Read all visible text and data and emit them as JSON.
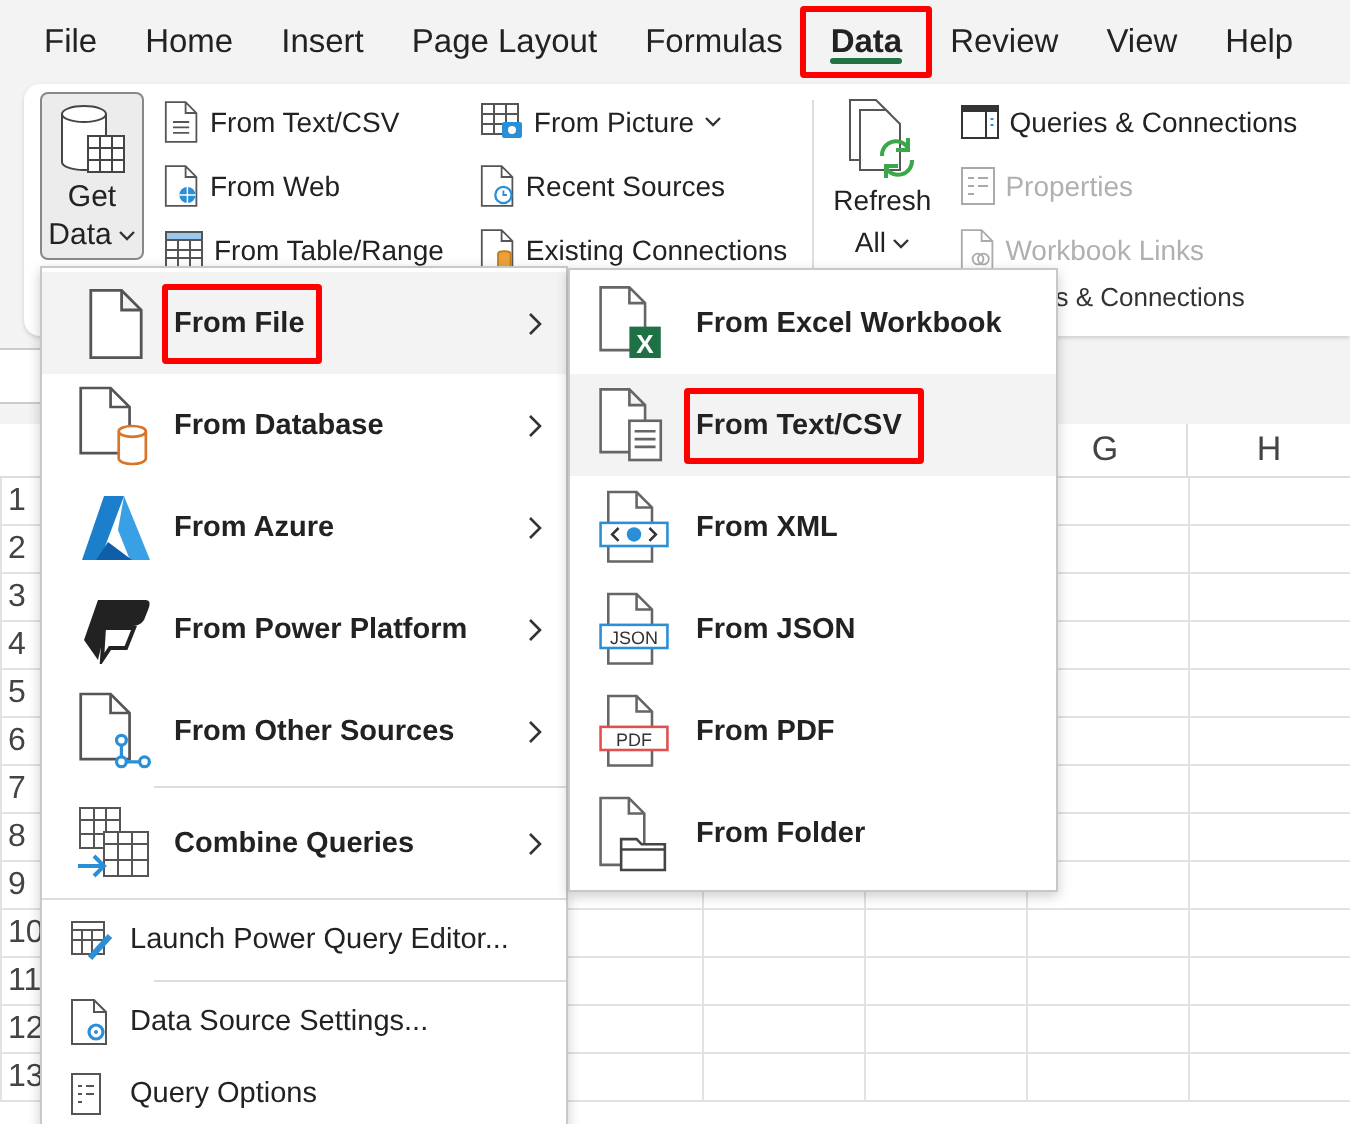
{
  "tabs": [
    {
      "label": "File",
      "selected": false,
      "annotated": false
    },
    {
      "label": "Home",
      "selected": false,
      "annotated": false
    },
    {
      "label": "Insert",
      "selected": false,
      "annotated": false
    },
    {
      "label": "Page Layout",
      "selected": false,
      "annotated": false
    },
    {
      "label": "Formulas",
      "selected": false,
      "annotated": false
    },
    {
      "label": "Data",
      "selected": true,
      "annotated": true
    },
    {
      "label": "Review",
      "selected": false,
      "annotated": false
    },
    {
      "label": "View",
      "selected": false,
      "annotated": false
    },
    {
      "label": "Help",
      "selected": false,
      "annotated": false
    }
  ],
  "ribbon": {
    "get_data": {
      "lines": [
        "Get",
        "Data"
      ],
      "pressed": true
    },
    "import_columns": [
      [
        {
          "label": "From Text/CSV",
          "dropdown": false
        },
        {
          "label": "From Web",
          "dropdown": false
        },
        {
          "label": "From Table/Range",
          "dropdown": false
        }
      ],
      [
        {
          "label": "From Picture",
          "dropdown": true
        },
        {
          "label": "Recent Sources",
          "dropdown": false
        },
        {
          "label": "Existing Connections",
          "dropdown": false
        }
      ]
    ],
    "refresh": {
      "lines": [
        "Refresh",
        "All"
      ]
    },
    "queries": [
      {
        "label": "Queries & Connections",
        "disabled": false
      },
      {
        "label": "Properties",
        "disabled": true
      },
      {
        "label": "Workbook Links",
        "disabled": true
      }
    ],
    "group_label": "s & Connections"
  },
  "grid": {
    "column_headers": [
      "G",
      "H"
    ],
    "row_headers": [
      "1",
      "2",
      "3",
      "4",
      "5",
      "6",
      "7",
      "8",
      "9",
      "10",
      "11",
      "12",
      "13"
    ]
  },
  "menu": {
    "sections": [
      [
        {
          "kind": "source",
          "label": "From File",
          "submenu": true,
          "selected": true,
          "annotated": true
        },
        {
          "kind": "source",
          "label": "From Database",
          "submenu": true,
          "selected": false,
          "annotated": false
        },
        {
          "kind": "source",
          "label": "From Azure",
          "submenu": true,
          "selected": false,
          "annotated": false
        },
        {
          "kind": "source",
          "label": "From Power Platform",
          "submenu": true,
          "selected": false,
          "annotated": false
        },
        {
          "kind": "source",
          "label": "From Other Sources",
          "submenu": true,
          "selected": false,
          "annotated": false
        }
      ],
      [
        {
          "kind": "source",
          "label": "Combine Queries",
          "submenu": true,
          "selected": false,
          "annotated": false
        }
      ],
      [
        {
          "kind": "command",
          "label": "Launch Power Query Editor...",
          "submenu": false,
          "selected": false,
          "annotated": false
        }
      ],
      [
        {
          "kind": "command",
          "label": "Data Source Settings...",
          "submenu": false,
          "selected": false,
          "annotated": false
        },
        {
          "kind": "command",
          "label": "Query Options",
          "submenu": false,
          "selected": false,
          "annotated": false
        }
      ]
    ]
  },
  "submenu": {
    "items": [
      {
        "label": "From Excel Workbook",
        "badge": "X",
        "selected": false,
        "annotated": false
      },
      {
        "label": "From Text/CSV",
        "selected": true,
        "annotated": true
      },
      {
        "label": "From XML",
        "selected": false,
        "annotated": false
      },
      {
        "label": "From JSON",
        "badge": "JSON",
        "selected": false,
        "annotated": false
      },
      {
        "label": "From PDF",
        "badge": "PDF",
        "selected": false,
        "annotated": false
      },
      {
        "label": "From Folder",
        "selected": false,
        "annotated": false
      }
    ]
  }
}
